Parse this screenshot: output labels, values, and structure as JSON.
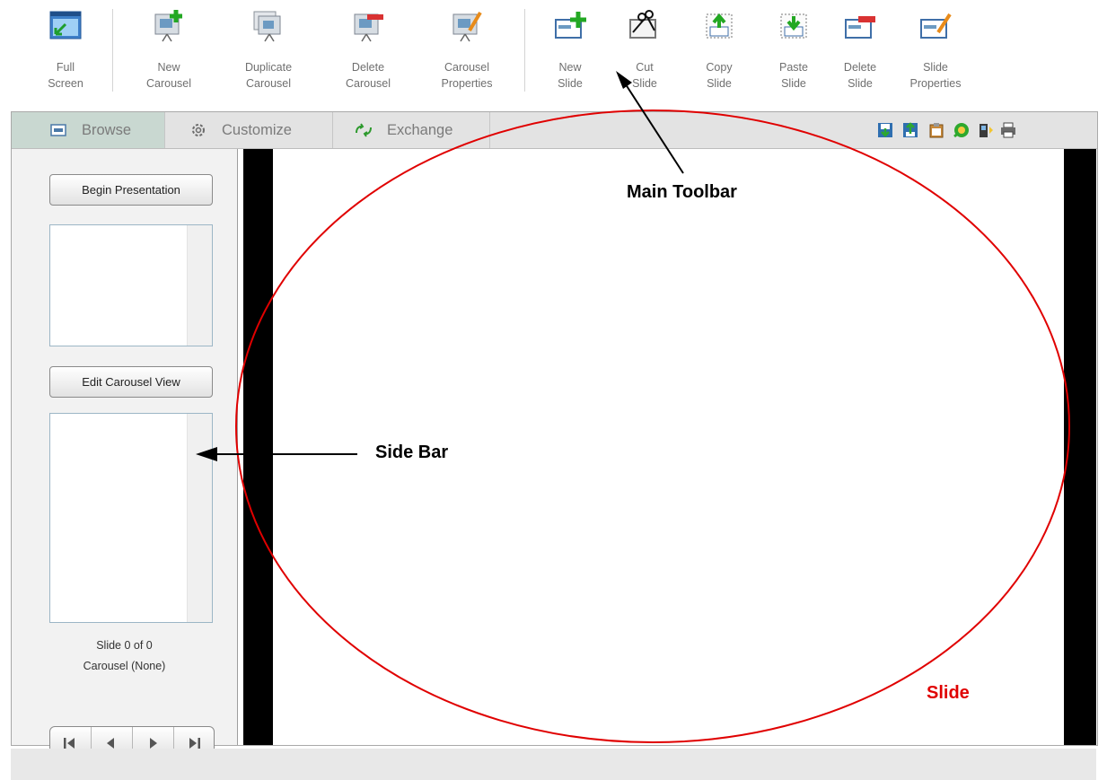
{
  "toolbar": {
    "full_screen": "Full\nScreen",
    "new_carousel": "New\nCarousel",
    "duplicate_carousel": "Duplicate\nCarousel",
    "delete_carousel": "Delete\nCarousel",
    "carousel_properties": "Carousel\nProperties",
    "new_slide": "New\nSlide",
    "cut_slide": "Cut\nSlide",
    "copy_slide": "Copy\nSlide",
    "paste_slide": "Paste\nSlide",
    "delete_slide": "Delete\nSlide",
    "slide_properties": "Slide\nProperties"
  },
  "tabs": {
    "browse": "Browse",
    "customize": "Customize",
    "exchange": "Exchange"
  },
  "sidebar": {
    "begin_presentation": "Begin Presentation",
    "edit_carousel_view": "Edit Carousel View",
    "slide_counter": "Slide 0 of 0",
    "carousel_name": "Carousel (None)"
  },
  "annotations": {
    "main_toolbar": "Main Toolbar",
    "side_bar": "Side Bar",
    "slide": "Slide"
  },
  "colors": {
    "annotation_black": "#000000",
    "annotation_red": "#e00000",
    "active_tab": "#c9d8d1"
  }
}
